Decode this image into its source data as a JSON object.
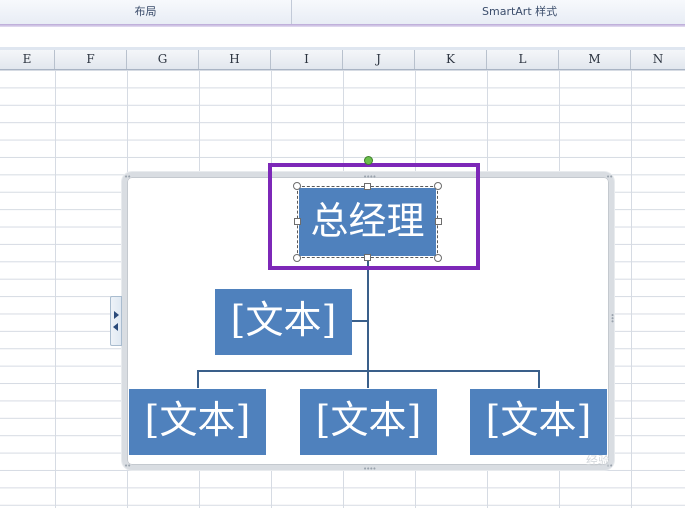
{
  "ribbon": {
    "groups": [
      "布局",
      "SmartArt 样式"
    ]
  },
  "columns": [
    "E",
    "F",
    "G",
    "H",
    "I",
    "J",
    "K",
    "L",
    "M",
    "N"
  ],
  "smartart": {
    "top_node": "总经理",
    "assistant_node": "[文本]",
    "child_nodes": [
      "[文本]",
      "[文本]",
      "[文本]"
    ],
    "colors": {
      "node_fill": "#4f81bd",
      "connector": "#3a5f8a",
      "selection": "#7d28b8"
    }
  },
  "watermark": "经验"
}
